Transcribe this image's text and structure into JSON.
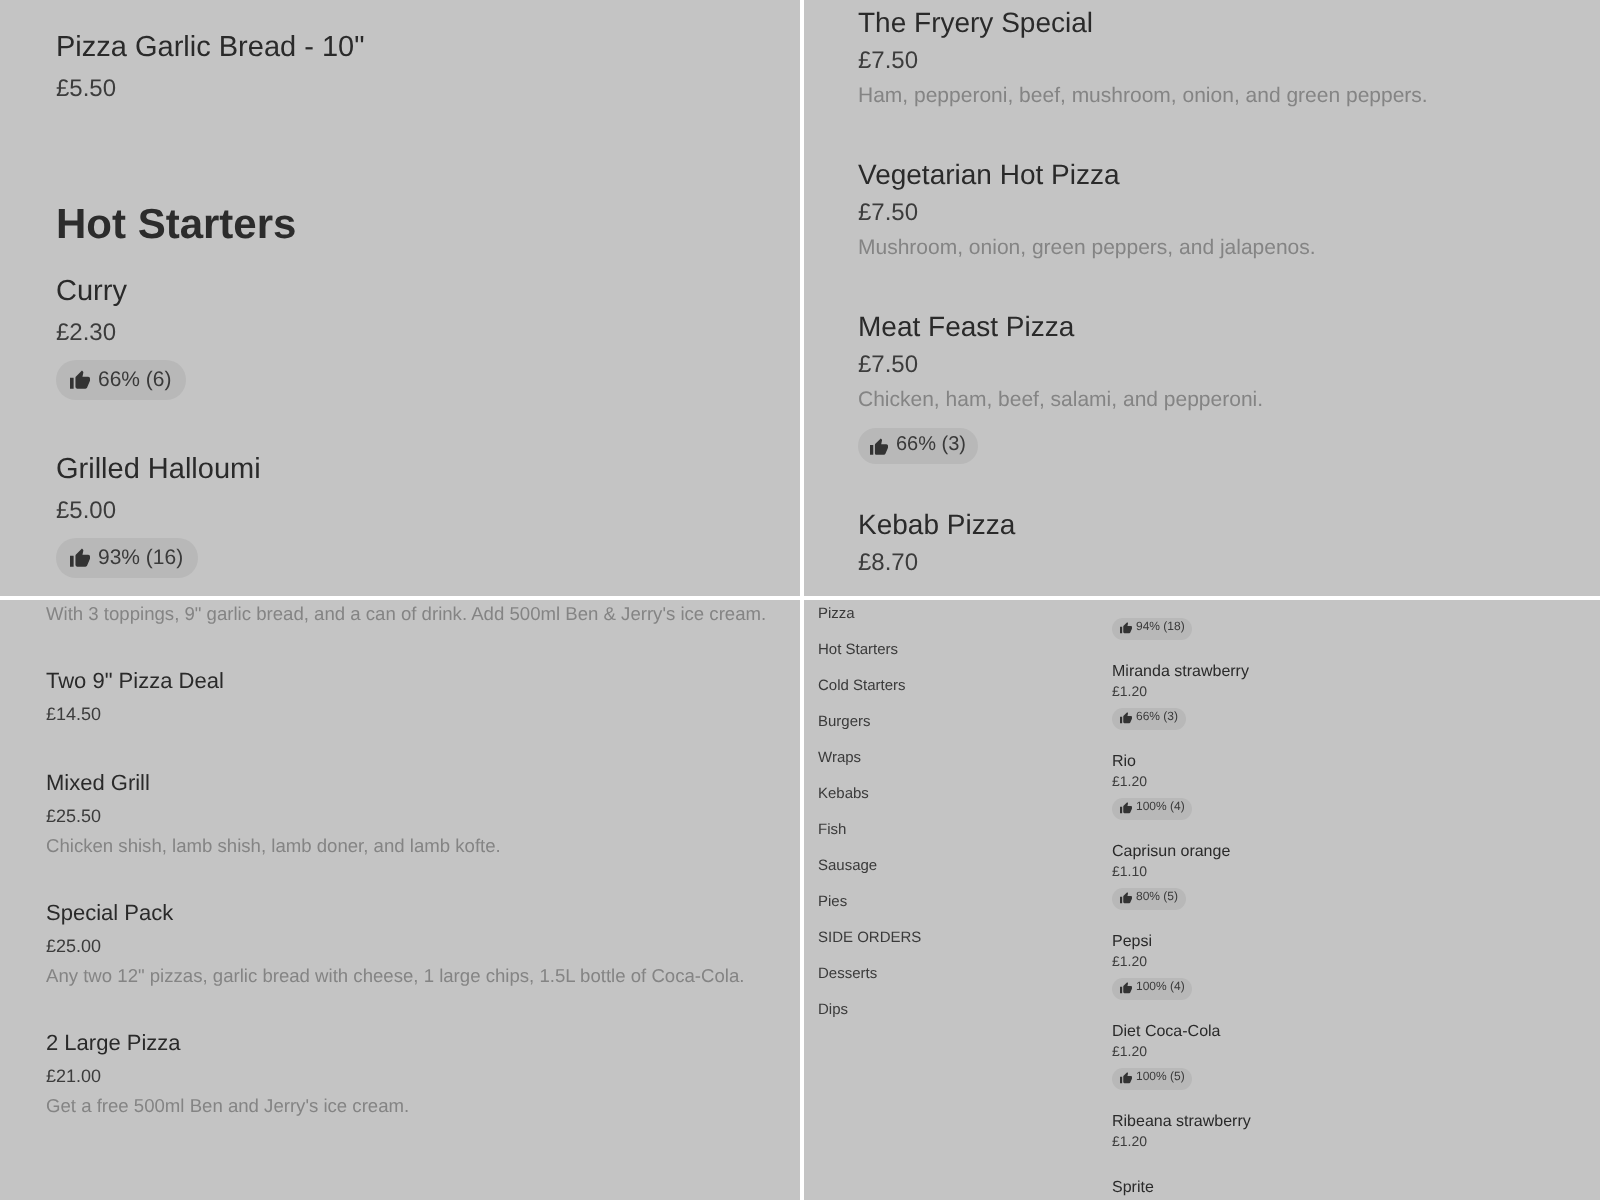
{
  "panels": [
    {
      "kind": "menu",
      "entries": [
        {
          "kind": "item",
          "name": "Pizza Garlic Bread - 10\"",
          "price": "£5.50"
        },
        {
          "kind": "heading",
          "title": "Hot Starters"
        },
        {
          "kind": "item",
          "name": "Curry",
          "price": "£2.30",
          "rating": "66% (6)"
        },
        {
          "kind": "item",
          "name": "Grilled Halloumi",
          "price": "£5.00",
          "rating": "93% (16)"
        }
      ]
    },
    {
      "kind": "menu",
      "entries": [
        {
          "kind": "item",
          "name": "The Fryery Special",
          "price": "£7.50",
          "description": "Ham, pepperoni, beef, mushroom, onion, and green peppers."
        },
        {
          "kind": "item",
          "name": "Vegetarian Hot Pizza",
          "price": "£7.50",
          "description": "Mushroom, onion, green peppers, and jalapenos."
        },
        {
          "kind": "item",
          "name": "Meat Feast Pizza",
          "price": "£7.50",
          "description": "Chicken, ham, beef, salami, and pepperoni.",
          "rating": "66% (3)"
        },
        {
          "kind": "item",
          "name": "Kebab Pizza",
          "price": "£8.70"
        }
      ]
    },
    {
      "kind": "menu",
      "entries": [
        {
          "kind": "item",
          "description": "With 3 toppings, 9\" garlic bread, and a can of drink. Add 500ml Ben & Jerry's ice cream."
        },
        {
          "kind": "item",
          "name": "Two 9\" Pizza Deal",
          "price": "£14.50"
        },
        {
          "kind": "item",
          "name": "Mixed Grill",
          "price": "£25.50",
          "description": "Chicken shish, lamb shish, lamb doner, and lamb kofte."
        },
        {
          "kind": "item",
          "name": "Special Pack",
          "price": "£25.00",
          "description": "Any two 12\" pizzas, garlic bread with cheese, 1 large chips, 1.5L bottle of Coca-Cola."
        },
        {
          "kind": "item",
          "name": "2 Large Pizza",
          "price": "£21.00",
          "description": "Get a free 500ml Ben and Jerry's ice cream."
        }
      ]
    },
    {
      "kind": "menu-with-categories",
      "categories": [
        "Pizza",
        "Hot Starters",
        "Cold Starters",
        "Burgers",
        "Wraps",
        "Kebabs",
        "Fish",
        "Sausage",
        "Pies",
        "SIDE ORDERS",
        "Desserts",
        "Dips"
      ],
      "entries": [
        {
          "kind": "item",
          "rating": "94% (18)"
        },
        {
          "kind": "item",
          "name": "Miranda strawberry",
          "price": "£1.20",
          "rating": "66% (3)"
        },
        {
          "kind": "item",
          "name": "Rio",
          "price": "£1.20",
          "rating": "100% (4)"
        },
        {
          "kind": "item",
          "name": "Caprisun orange",
          "price": "£1.10",
          "rating": "80% (5)"
        },
        {
          "kind": "item",
          "name": "Pepsi",
          "price": "£1.20",
          "rating": "100% (4)"
        },
        {
          "kind": "item",
          "name": "Diet Coca-Cola",
          "price": "£1.20",
          "rating": "100% (5)"
        },
        {
          "kind": "item",
          "name": "Ribeana strawberry",
          "price": "£1.20"
        },
        {
          "kind": "item",
          "name": "Sprite"
        }
      ]
    }
  ]
}
